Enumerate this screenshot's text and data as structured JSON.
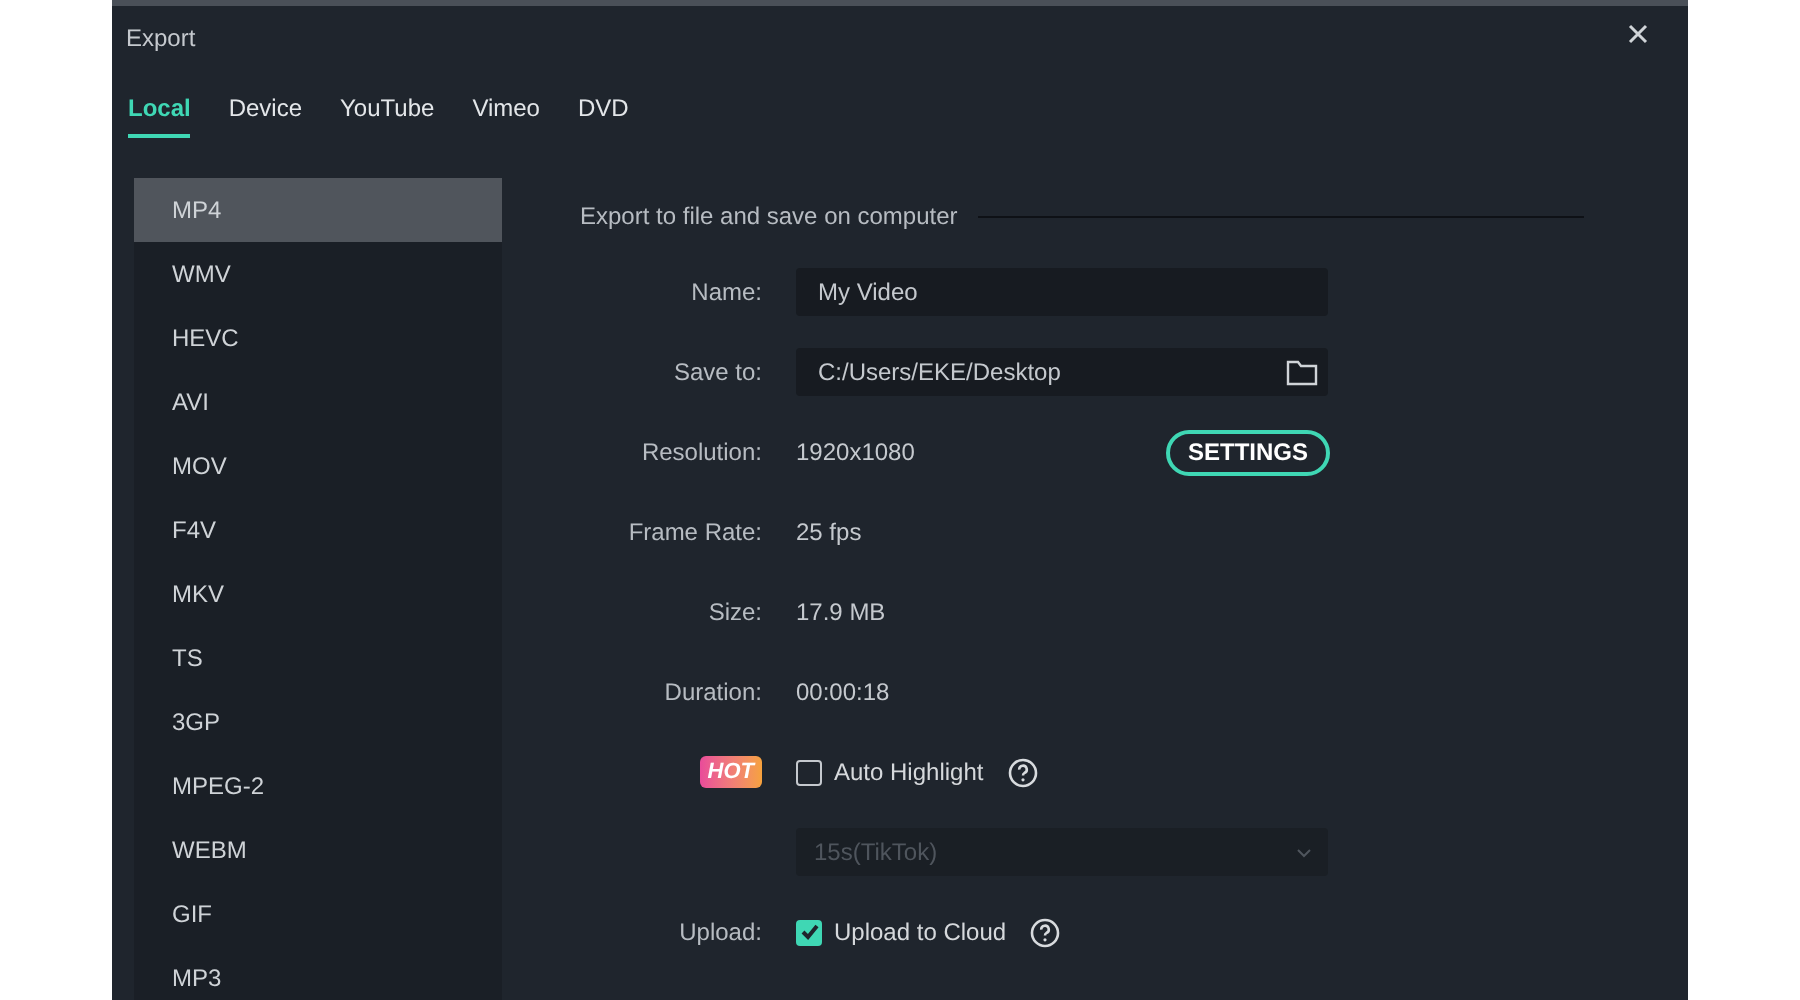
{
  "window": {
    "title": "Export"
  },
  "tabs": [
    {
      "label": "Local",
      "selected": true
    },
    {
      "label": "Device",
      "selected": false
    },
    {
      "label": "YouTube",
      "selected": false
    },
    {
      "label": "Vimeo",
      "selected": false
    },
    {
      "label": "DVD",
      "selected": false
    }
  ],
  "formats": [
    {
      "label": "MP4",
      "selected": true
    },
    {
      "label": "WMV",
      "selected": false
    },
    {
      "label": "HEVC",
      "selected": false
    },
    {
      "label": "AVI",
      "selected": false
    },
    {
      "label": "MOV",
      "selected": false
    },
    {
      "label": "F4V",
      "selected": false
    },
    {
      "label": "MKV",
      "selected": false
    },
    {
      "label": "TS",
      "selected": false
    },
    {
      "label": "3GP",
      "selected": false
    },
    {
      "label": "MPEG-2",
      "selected": false
    },
    {
      "label": "WEBM",
      "selected": false
    },
    {
      "label": "GIF",
      "selected": false
    },
    {
      "label": "MP3",
      "selected": false
    }
  ],
  "section_title": "Export to file and save on computer",
  "rows": [
    {
      "kind": "field",
      "label": "Name:",
      "value": "My Video"
    },
    {
      "kind": "folder",
      "label": "Save to:",
      "value": "C:/Users/EKE/Desktop"
    },
    {
      "kind": "settings",
      "label": "Resolution:",
      "value": "1920x1080",
      "button": "SETTINGS"
    },
    {
      "kind": "text",
      "label": "Frame Rate:",
      "value": "25 fps"
    },
    {
      "kind": "text",
      "label": "Size:",
      "value": "17.9 MB"
    },
    {
      "kind": "text",
      "label": "Duration:",
      "value": "00:00:18"
    },
    {
      "kind": "check",
      "badge": "HOT",
      "value": "Auto Highlight",
      "checked": false
    },
    {
      "kind": "select",
      "value": "15s(TikTok)",
      "disabled": true
    },
    {
      "kind": "check",
      "label": "Upload:",
      "value": "Upload to Cloud",
      "checked": true
    }
  ]
}
